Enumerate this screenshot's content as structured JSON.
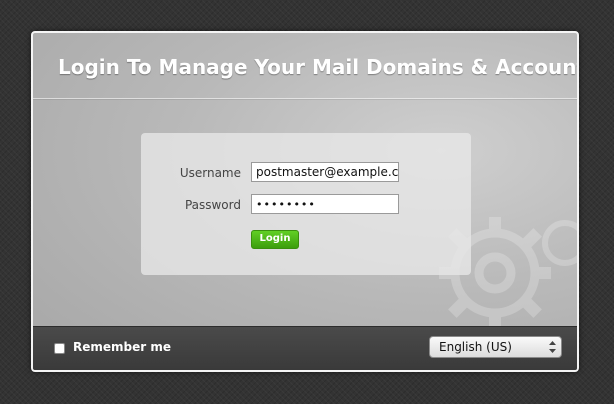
{
  "header": {
    "title": "Login To Manage Your Mail Domains & Accounts"
  },
  "form": {
    "username_label": "Username",
    "username_value": "postmaster@example.com",
    "password_label": "Password",
    "password_masked": "••••••••",
    "login_label": "Login"
  },
  "footer": {
    "remember_label": "Remember me",
    "remember_checked": false,
    "language_value": "English (US)"
  },
  "icons": {
    "checkbox": "checkbox-icon",
    "select_arrows": "select-arrows-icon",
    "watermark": "gear-icon"
  },
  "colors": {
    "accent_button": "#4cb719",
    "footer_bg": "#404040",
    "title_text": "#ffffff"
  }
}
